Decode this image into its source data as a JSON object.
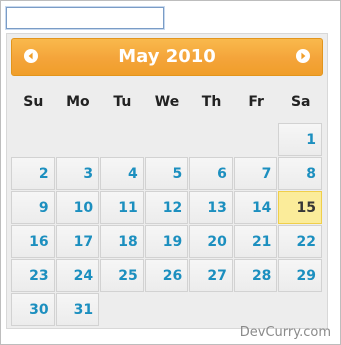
{
  "date_input": {
    "value": ""
  },
  "calendar": {
    "month_year": "May 2010",
    "prev_icon": "chevron-left-icon",
    "next_icon": "chevron-right-icon",
    "weekdays": [
      "Su",
      "Mo",
      "Tu",
      "We",
      "Th",
      "Fr",
      "Sa"
    ],
    "leading_blanks": 6,
    "days": [
      "1",
      "2",
      "3",
      "4",
      "5",
      "6",
      "7",
      "8",
      "9",
      "10",
      "11",
      "12",
      "13",
      "14",
      "15",
      "16",
      "17",
      "18",
      "19",
      "20",
      "21",
      "22",
      "23",
      "24",
      "25",
      "26",
      "27",
      "28",
      "29",
      "30",
      "31"
    ],
    "today": "15"
  },
  "colors": {
    "header": "#f4a43a",
    "day_text": "#1c8fbf",
    "today_bg": "#fbec9a"
  },
  "watermark": "DevCurry.com"
}
